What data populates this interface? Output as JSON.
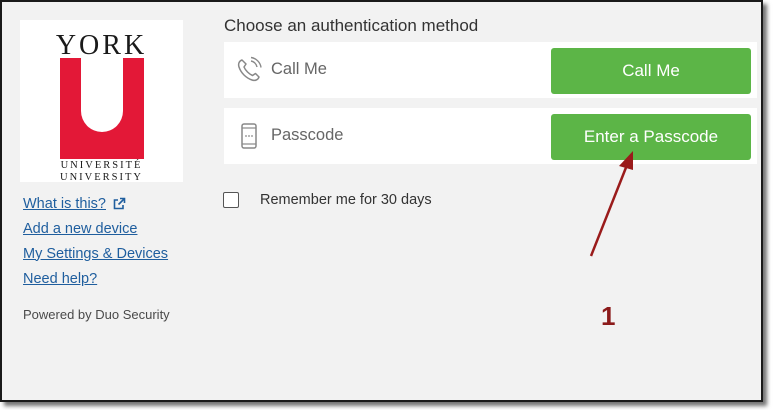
{
  "logo": {
    "word_top": "YORK",
    "line_fr": "UNIVERSITÉ",
    "line_en": "UNIVERSITY",
    "brand_color": "#e31837"
  },
  "sidebar": {
    "links": [
      {
        "label": "What is this?",
        "icon": "external-link-icon"
      },
      {
        "label": "Add a new device"
      },
      {
        "label": "My Settings & Devices"
      },
      {
        "label": "Need help?"
      }
    ],
    "powered_by": "Powered by Duo Security"
  },
  "main": {
    "heading": "Choose an authentication method",
    "methods": [
      {
        "icon": "phone-call-icon",
        "label": "Call Me",
        "button": "Call Me"
      },
      {
        "icon": "mobile-device-icon",
        "label": "Passcode",
        "button": "Enter a Passcode"
      }
    ],
    "remember_label": "Remember me for 30 days",
    "remember_checked": false
  },
  "annotation": {
    "number": "1",
    "color": "#8b1a1a"
  },
  "colors": {
    "button_green": "#5cb547",
    "link_blue": "#1f5e9e",
    "panel_gray": "#f2f2f2"
  }
}
